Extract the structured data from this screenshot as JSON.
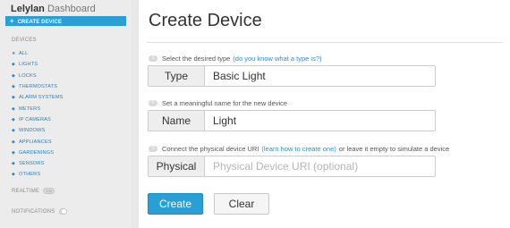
{
  "sidebar": {
    "brand_bold": "Lelylan",
    "brand_light": "Dashboard",
    "create_label": "CREATE DEVICE",
    "devices_heading": "DEVICES",
    "items": [
      {
        "label": "ALL",
        "icon": "star-icon"
      },
      {
        "label": "LIGHTS",
        "icon": "tag-icon"
      },
      {
        "label": "LOCKS",
        "icon": "tag-icon"
      },
      {
        "label": "THERMOSTATS",
        "icon": "tag-icon"
      },
      {
        "label": "ALARM SYSTEMS",
        "icon": "tag-icon"
      },
      {
        "label": "METERS",
        "icon": "tag-icon"
      },
      {
        "label": "IP CAMERAS",
        "icon": "tag-icon"
      },
      {
        "label": "WINDOWS",
        "icon": "tag-icon"
      },
      {
        "label": "APPLIANCES",
        "icon": "tag-icon"
      },
      {
        "label": "GARDENINGS",
        "icon": "tag-icon"
      },
      {
        "label": "SENSORS",
        "icon": "tag-icon"
      },
      {
        "label": "OTHERS",
        "icon": "tag-icon"
      }
    ],
    "realtime_label": "REALTIME",
    "realtime_toggle": "ON",
    "notifications_label": "NOTIFICATIONS"
  },
  "main": {
    "title": "Create Device",
    "step1": {
      "num": "1",
      "text": "Select the desired type",
      "link": "(do you know what a type is?)"
    },
    "type_field": {
      "label": "Type",
      "value": "Basic Light"
    },
    "step2": {
      "num": "2",
      "text": "Set a meaningful name for the new device"
    },
    "name_field": {
      "label": "Name",
      "value": "Light"
    },
    "step3": {
      "num": "3",
      "text": "Connect the physical device URI",
      "link": "(learn how to create one)",
      "text_after": "or leave it empty to simulate a device"
    },
    "physical_field": {
      "label": "Physical",
      "value": "",
      "placeholder": "Physical Device URI (optional)"
    },
    "create_button": "Create",
    "clear_button": "Clear"
  },
  "colors": {
    "accent": "#2a9fd6",
    "link": "#2a7fb8"
  }
}
